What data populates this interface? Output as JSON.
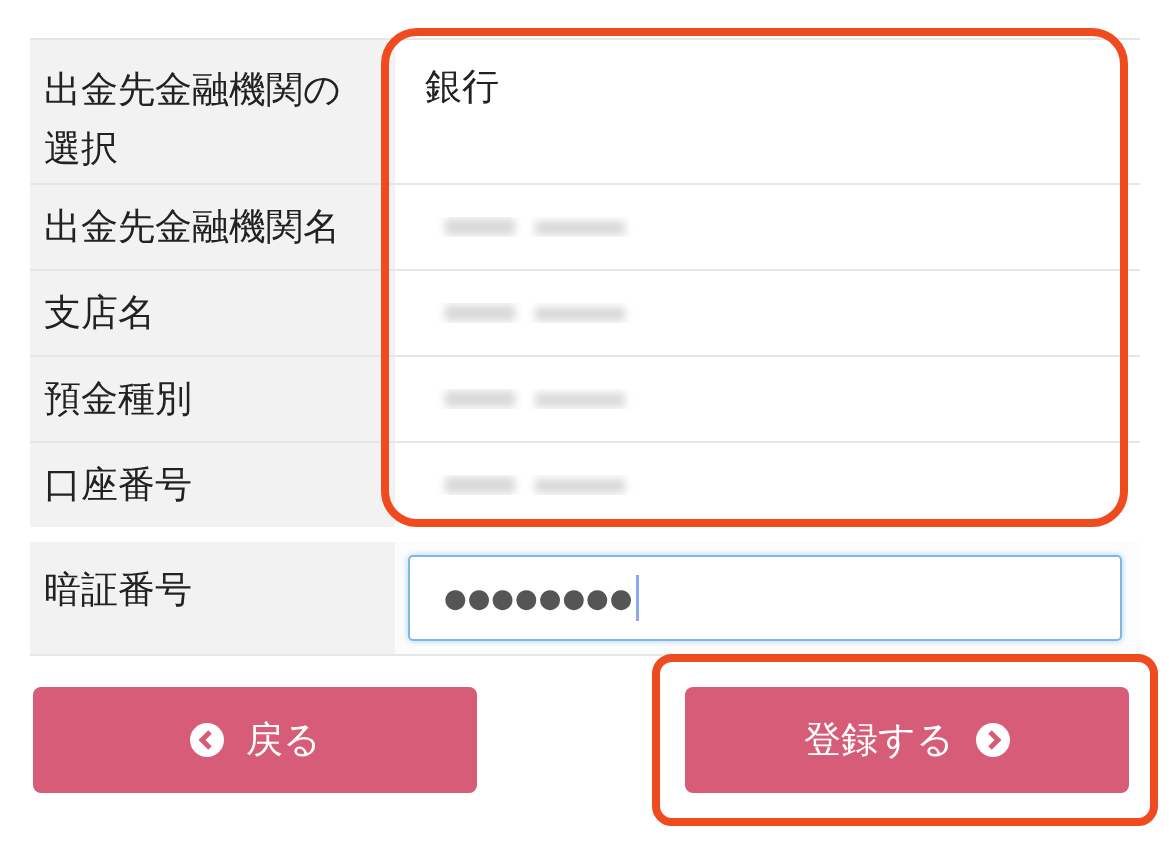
{
  "rows": [
    {
      "label": "出金先金融機関の選択",
      "value": "銀行",
      "redacted": false
    },
    {
      "label": "出金先金融機関名",
      "redacted": true
    },
    {
      "label": "支店名",
      "redacted": true
    },
    {
      "label": "預金種別",
      "redacted": true
    },
    {
      "label": "口座番号",
      "redacted": true
    }
  ],
  "pin": {
    "label": "暗証番号",
    "value": "●●●●●●●●",
    "focused": true
  },
  "buttons": [
    {
      "kind": "back",
      "label": "戻る",
      "highlighted": false
    },
    {
      "kind": "next",
      "label": "登録する",
      "highlighted": true
    }
  ],
  "highlight_rows": true
}
